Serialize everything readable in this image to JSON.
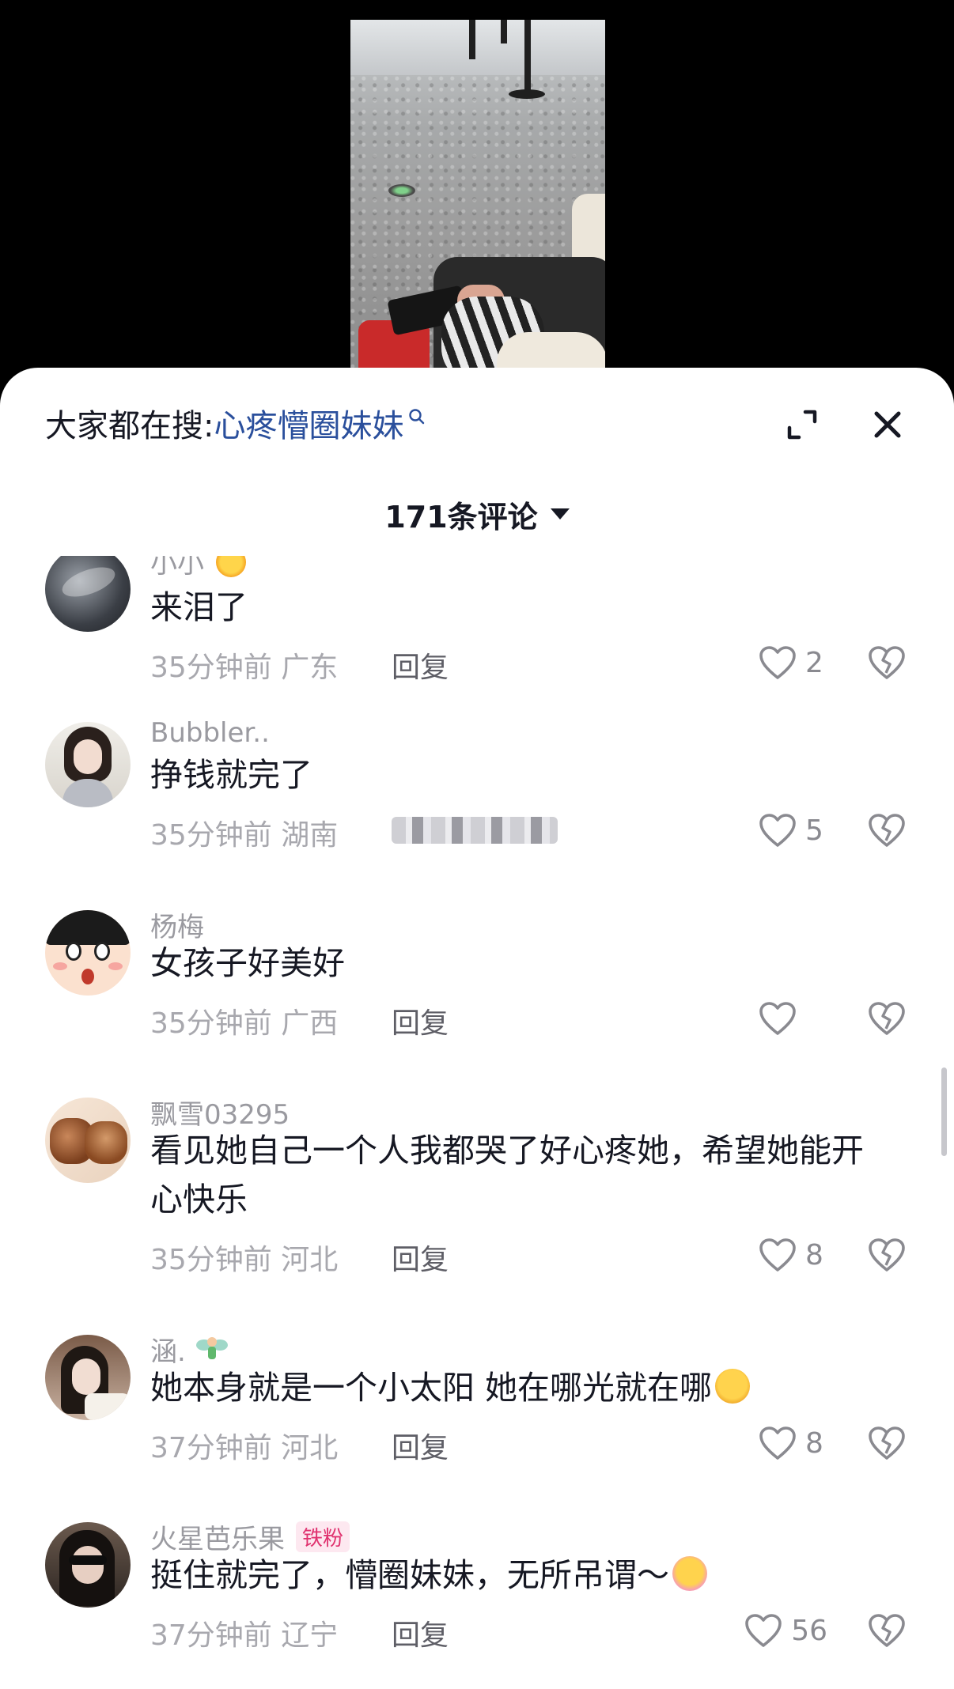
{
  "search": {
    "prefix": "大家都在搜:",
    "term": "心疼懵圈妹妹"
  },
  "comment_count_label": "171条评论",
  "comments": [
    {
      "username": "小小",
      "text": "来泪了",
      "time": "35分钟前",
      "location": "广东",
      "reply": "回复",
      "likes": "2",
      "avatar": "avatar-dark-texture"
    },
    {
      "username": "Bubbler..",
      "text": "挣钱就完了",
      "time": "35分钟前",
      "location": "湖南",
      "reply": "",
      "likes": "5",
      "avatar": "avatar-girl-glasses"
    },
    {
      "username": "杨梅",
      "text": "女孩子好美好",
      "time": "35分钟前",
      "location": "广西",
      "reply": "回复",
      "likes": "",
      "avatar": "avatar-cartoon-face"
    },
    {
      "username": "飘雪03295",
      "text": "看见她自己一个人我都哭了好心疼她，希望她能开心快乐",
      "time": "35分钟前",
      "location": "河北",
      "reply": "回复",
      "likes": "8",
      "avatar": "avatar-food"
    },
    {
      "username": "涵.",
      "text": "她本身就是一个小太阳 她在哪光就在哪",
      "time": "37分钟前",
      "location": "河北",
      "reply": "回复",
      "likes": "8",
      "avatar": "avatar-woman-portrait"
    },
    {
      "username": "火星芭乐果",
      "badge": "铁粉",
      "text": "挺住就完了，懵圈妹妹，无所吊谓～",
      "time": "37分钟前",
      "location": "辽宁",
      "reply": "回复",
      "likes": "56",
      "avatar": "avatar-woman-sunglasses"
    }
  ],
  "colors": {
    "search_term": "#2a4f9c",
    "text_primary": "#161823",
    "text_muted": "#a8a8ae",
    "badge_text": "#e0326f",
    "badge_bg": "#fde8f0"
  }
}
